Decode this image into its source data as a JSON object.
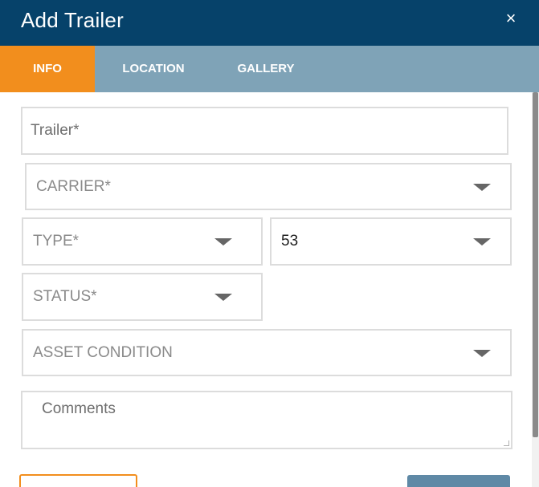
{
  "dialog": {
    "title": "Add Trailer",
    "close_icon": "×"
  },
  "tabs": [
    {
      "label": "INFO",
      "active": true
    },
    {
      "label": "LOCATION",
      "active": false
    },
    {
      "label": "GALLERY",
      "active": false
    }
  ],
  "form": {
    "trailer": {
      "placeholder": "Trailer*"
    },
    "carrier": {
      "placeholder": "CARRIER*"
    },
    "type": {
      "placeholder": "TYPE*"
    },
    "length": {
      "value": "53"
    },
    "status": {
      "placeholder": "STATUS*"
    },
    "asset_condition": {
      "placeholder": "ASSET CONDITION"
    },
    "comments": {
      "placeholder": "Comments"
    }
  },
  "colors": {
    "header": "#06426a",
    "tab_bar": "#7fa3b7",
    "active_tab": "#f28e1d",
    "primary_button": "#5f89a6"
  },
  "icons": {
    "close": "close-icon",
    "dropdown": "chevron-down-icon"
  }
}
